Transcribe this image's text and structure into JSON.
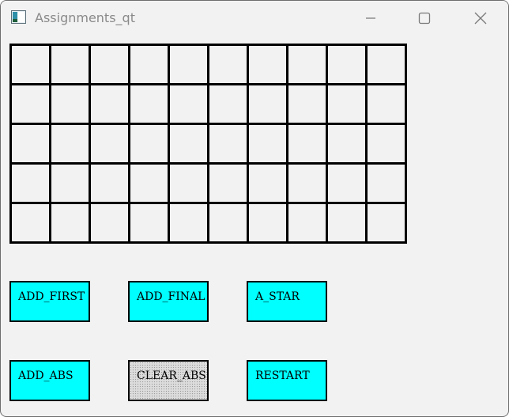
{
  "window": {
    "title": "Assignments_qt"
  },
  "icons": {
    "app": "app-window-icon",
    "minimize": "minimize-icon",
    "maximize": "maximize-icon",
    "close": "close-icon"
  },
  "grid": {
    "rows": 5,
    "columns": 10,
    "cell_color": "#f2f2f2",
    "line_color": "#000000"
  },
  "buttons": {
    "add_first": "ADD_FIRST",
    "add_final": "ADD_FINAL",
    "a_star": "A_STAR",
    "add_abs": "ADD_ABS",
    "clear_abs": "CLEAR_ABS",
    "restart": "RESTART"
  },
  "colors": {
    "button_fill": "#00ffff",
    "clear_button_fill": "#dcdcdc",
    "window_background": "#f2f2f2"
  }
}
